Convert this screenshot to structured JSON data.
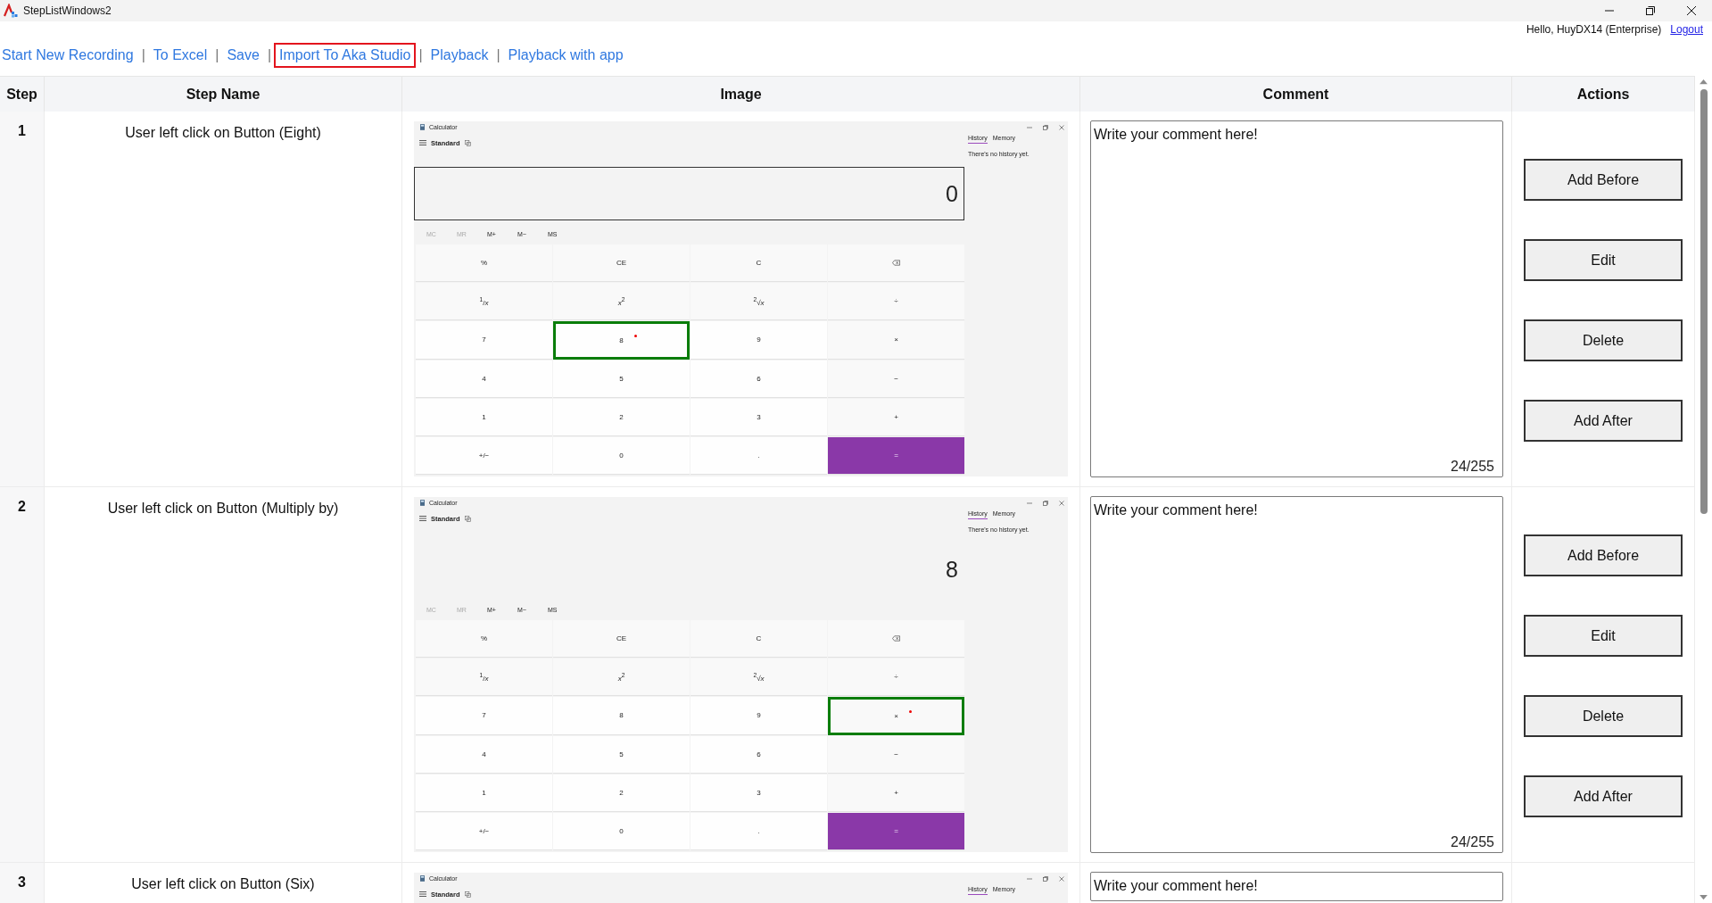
{
  "window": {
    "title": "StepListWindows2"
  },
  "toolbar": {
    "separator": "|",
    "links": [
      {
        "label": "Start New Recording",
        "highlighted": false
      },
      {
        "label": "To Excel",
        "highlighted": false
      },
      {
        "label": "Save",
        "highlighted": false
      },
      {
        "label": "Import To Aka Studio",
        "highlighted": true
      },
      {
        "label": "Playback",
        "highlighted": false
      },
      {
        "label": "Playback with app",
        "highlighted": false
      }
    ]
  },
  "user": {
    "greeting": "Hello, HuyDX14 (Enterprise)",
    "logout": "Logout"
  },
  "table": {
    "columns": [
      "Step",
      "Step Name",
      "Image",
      "Comment",
      "Actions"
    ],
    "rows": [
      {
        "step": "1",
        "step_name": "User left click on Button (Eight)",
        "image": {
          "app_title": "Calculator",
          "mode": "Standard",
          "display": "0",
          "display_boxed": true,
          "memory_keys": [
            {
              "label": "MC",
              "disabled": true
            },
            {
              "label": "MR",
              "disabled": true
            },
            {
              "label": "M+",
              "disabled": false
            },
            {
              "label": "M−",
              "disabled": false
            },
            {
              "label": "MS",
              "disabled": false
            }
          ],
          "keys": [
            {
              "label": "%",
              "kind": "function",
              "selected": false
            },
            {
              "label": "CE",
              "kind": "function",
              "selected": false
            },
            {
              "label": "C",
              "kind": "function",
              "selected": false
            },
            {
              "kind": "backspace",
              "selected": false
            },
            {
              "label": "$^{1}$/*x*",
              "kind": "function",
              "selected": false
            },
            {
              "label": "*x*$^{2}$",
              "kind": "function",
              "selected": false
            },
            {
              "label": "$^{2}$√*x*",
              "kind": "function",
              "selected": false
            },
            {
              "label": "÷",
              "kind": "operator",
              "selected": false
            },
            {
              "label": "7",
              "kind": "digit",
              "selected": false
            },
            {
              "label": "8",
              "kind": "digit",
              "selected": true
            },
            {
              "label": "9",
              "kind": "digit",
              "selected": false
            },
            {
              "label": "×",
              "kind": "operator",
              "selected": false
            },
            {
              "label": "4",
              "kind": "digit",
              "selected": false
            },
            {
              "label": "5",
              "kind": "digit",
              "selected": false
            },
            {
              "label": "6",
              "kind": "digit",
              "selected": false
            },
            {
              "label": "−",
              "kind": "operator",
              "selected": false
            },
            {
              "label": "1",
              "kind": "digit",
              "selected": false
            },
            {
              "label": "2",
              "kind": "digit",
              "selected": false
            },
            {
              "label": "3",
              "kind": "digit",
              "selected": false
            },
            {
              "label": "+",
              "kind": "operator",
              "selected": false
            },
            {
              "label": "+/−",
              "kind": "digit",
              "selected": false
            },
            {
              "label": "0",
              "kind": "digit",
              "selected": false
            },
            {
              "label": ".",
              "kind": "digit",
              "selected": false
            },
            {
              "label": "=",
              "kind": "equals",
              "selected": false
            }
          ],
          "side_tabs": [
            {
              "label": "History",
              "selected": true
            },
            {
              "label": "Memory",
              "selected": false
            }
          ],
          "history_note": "There's no history yet."
        },
        "comment": {
          "value": "Write your comment here!",
          "counter": "24/255"
        },
        "actions": [
          "Add Before",
          "Edit",
          "Delete",
          "Add After"
        ]
      },
      {
        "step": "2",
        "step_name": "User left click on Button (Multiply by)",
        "image": {
          "app_title": "Calculator",
          "mode": "Standard",
          "display": "8",
          "display_boxed": false,
          "memory_keys": [
            {
              "label": "MC",
              "disabled": true
            },
            {
              "label": "MR",
              "disabled": true
            },
            {
              "label": "M+",
              "disabled": false
            },
            {
              "label": "M−",
              "disabled": false
            },
            {
              "label": "MS",
              "disabled": false
            }
          ],
          "keys": [
            {
              "label": "%",
              "kind": "function",
              "selected": false
            },
            {
              "label": "CE",
              "kind": "function",
              "selected": false
            },
            {
              "label": "C",
              "kind": "function",
              "selected": false
            },
            {
              "kind": "backspace",
              "selected": false
            },
            {
              "label": "$^{1}$/*x*",
              "kind": "function",
              "selected": false
            },
            {
              "label": "*x*$^{2}$",
              "kind": "function",
              "selected": false
            },
            {
              "label": "$^{2}$√*x*",
              "kind": "function",
              "selected": false
            },
            {
              "label": "÷",
              "kind": "operator",
              "selected": false
            },
            {
              "label": "7",
              "kind": "digit",
              "selected": false
            },
            {
              "label": "8",
              "kind": "digit",
              "selected": false
            },
            {
              "label": "9",
              "kind": "digit",
              "selected": false
            },
            {
              "label": "×",
              "kind": "operator",
              "selected": true
            },
            {
              "label": "4",
              "kind": "digit",
              "selected": false
            },
            {
              "label": "5",
              "kind": "digit",
              "selected": false
            },
            {
              "label": "6",
              "kind": "digit",
              "selected": false
            },
            {
              "label": "−",
              "kind": "operator",
              "selected": false
            },
            {
              "label": "1",
              "kind": "digit",
              "selected": false
            },
            {
              "label": "2",
              "kind": "digit",
              "selected": false
            },
            {
              "label": "3",
              "kind": "digit",
              "selected": false
            },
            {
              "label": "+",
              "kind": "operator",
              "selected": false
            },
            {
              "label": "+/−",
              "kind": "digit",
              "selected": false
            },
            {
              "label": "0",
              "kind": "digit",
              "selected": false
            },
            {
              "label": ".",
              "kind": "digit",
              "selected": false
            },
            {
              "label": "=",
              "kind": "equals",
              "selected": false
            }
          ],
          "side_tabs": [
            {
              "label": "History",
              "selected": true
            },
            {
              "label": "Memory",
              "selected": false
            }
          ],
          "history_note": "There's no history yet."
        },
        "comment": {
          "value": "Write your comment here!",
          "counter": "24/255"
        },
        "actions": [
          "Add Before",
          "Edit",
          "Delete",
          "Add After"
        ]
      },
      {
        "step": "3",
        "step_name": "User left click on Button (Six)",
        "image": {
          "app_title": "Calculator",
          "mode": "Standard",
          "side_tabs": [
            {
              "label": "History",
              "selected": true
            },
            {
              "label": "Memory",
              "selected": false
            }
          ]
        },
        "comment": {
          "value": "Write your comment here!"
        }
      }
    ]
  }
}
